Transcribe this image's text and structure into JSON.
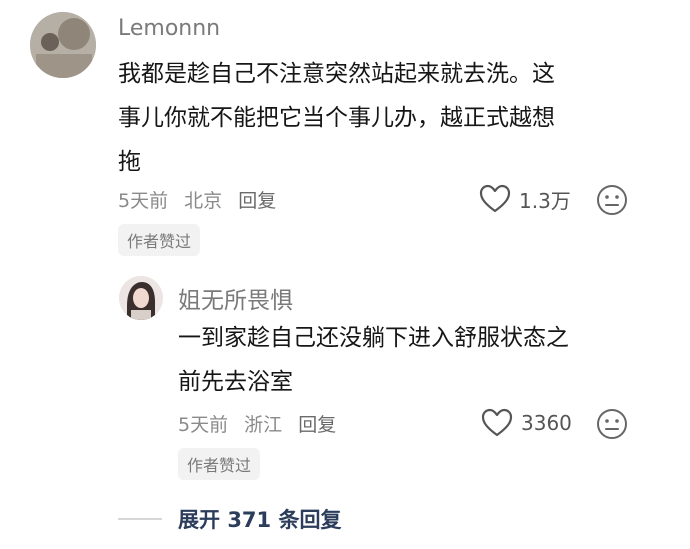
{
  "comment": {
    "username": "Lemonnn",
    "text_lines": [
      "我都是趁自己不注意突然站起来就去洗。这",
      "事儿你就不能把它当个事儿办，越正式越想",
      "拖"
    ],
    "time": "5天前",
    "location": "北京",
    "reply_label": "回复",
    "likes": "1.3万",
    "badge": "作者赞过"
  },
  "reply": {
    "username": "姐无所畏惧",
    "text_lines": [
      "一到家趁自己还没躺下进入舒服状态之",
      "前先去浴室"
    ],
    "time": "5天前",
    "location": "浙江",
    "reply_label": "回复",
    "likes": "3360",
    "badge": "作者赞过"
  },
  "expand": {
    "prefix": "展开",
    "count": "371",
    "suffix": "条回复"
  },
  "icons": {
    "like": "heart-outline-icon",
    "emoji": "neutral-face-icon",
    "divider": "divider-line"
  },
  "colors": {
    "username": "#7a7a7a",
    "meta": "#8a8a8a",
    "expand_link": "#2b3d5b",
    "badge_bg": "#f2f2f2"
  }
}
